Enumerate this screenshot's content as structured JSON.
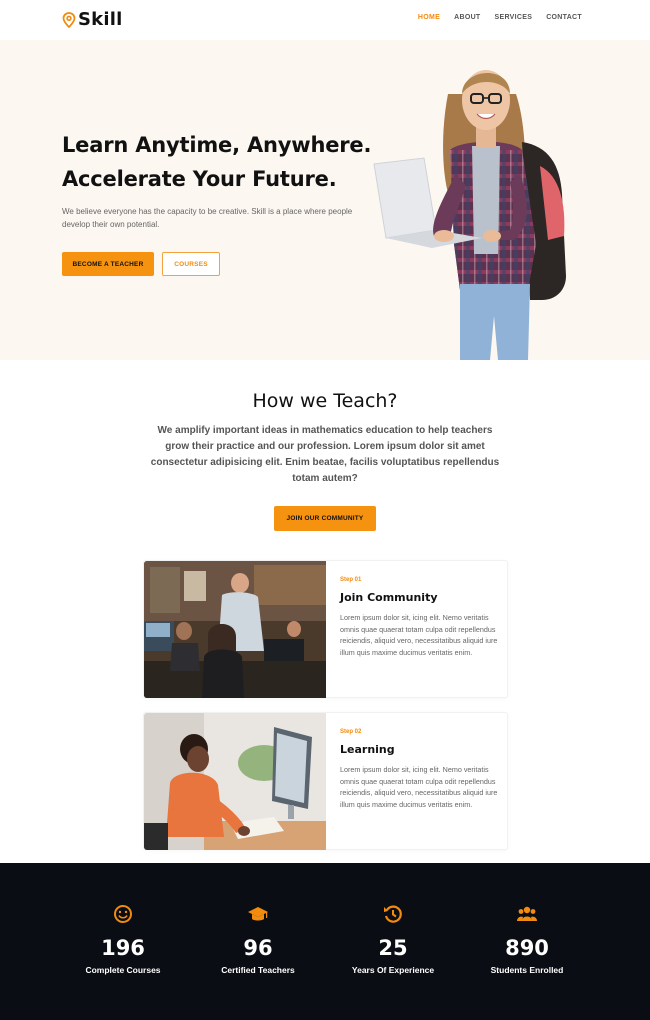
{
  "brand": {
    "name": "Skill",
    "accent": "#f28c0f",
    "dark_bg": "#0b0d14",
    "hero_bg": "#fdf7f2"
  },
  "nav": {
    "items": [
      {
        "label": "HOME",
        "active": true
      },
      {
        "label": "ABOUT",
        "active": false
      },
      {
        "label": "SERVICES",
        "active": false
      },
      {
        "label": "CONTACT",
        "active": false
      }
    ]
  },
  "hero": {
    "title_line1": "Learn Anytime, Anywhere.",
    "title_line2": "Accelerate Your Future.",
    "description": "We believe everyone has the capacity to be creative. Skill is a place where people develop their own potential.",
    "primary_button": "BECOME A TEACHER",
    "secondary_button": "COURSES"
  },
  "teach": {
    "title": "How we Teach?",
    "description": "We amplify important ideas in mathematics education to help teachers grow their practice and our profession. Lorem ipsum dolor sit amet consectetur adipisicing elit. Enim beatae, facilis voluptatibus repellendus totam autem?",
    "button": "JOIN OUR COMMUNITY"
  },
  "steps": [
    {
      "step": "Step 01",
      "title": "Join Community",
      "text": "Lorem ipsum dolor sit, icing elit. Nemo veritatis omnis quae quaerat totam culpa odit repellendus reiciendis, aliquid vero, necessitatibus aliquid iure illum quis maxime ducimus veritatis enim."
    },
    {
      "step": "Step 02",
      "title": "Learning",
      "text": "Lorem ipsum dolor sit, icing elit. Nemo veritatis omnis quae quaerat totam culpa odit repellendus reiciendis, aliquid vero, necessitatibus aliquid iure illum quis maxime ducimus veritatis enim."
    }
  ],
  "stats": [
    {
      "icon": "smile-icon",
      "value": "196",
      "label": "Complete Courses"
    },
    {
      "icon": "graduation-cap-icon",
      "value": "96",
      "label": "Certified Teachers"
    },
    {
      "icon": "history-icon",
      "value": "25",
      "label": "Years Of Experience"
    },
    {
      "icon": "users-icon",
      "value": "890",
      "label": "Students Enrolled"
    }
  ]
}
